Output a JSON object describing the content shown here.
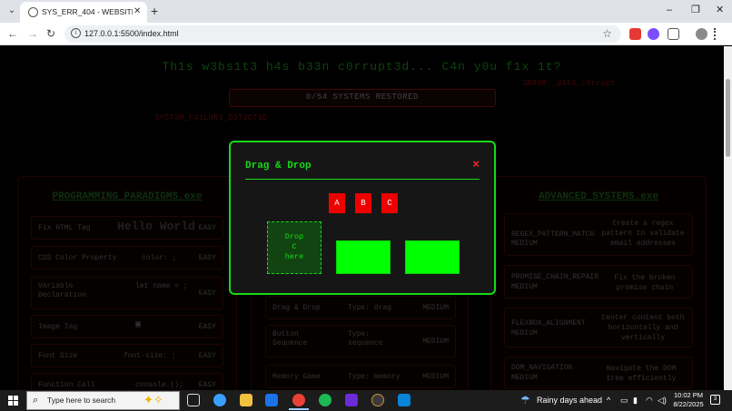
{
  "browser": {
    "tab_title": "SYS_ERR_404 - WEBSITE CORRUPTED",
    "url": "127.0.0.1:5500/index.html",
    "new_tab": "+",
    "tab_close": "✕",
    "window_buttons": {
      "minimize": "–",
      "restore": "❐",
      "close": "✕"
    }
  },
  "page": {
    "heading": "Th1s w3bs1t3 h4s b33n c0rrupt3d... C4n y0u f1x 1t?",
    "glitch_red_1": "3RR0R:_d4t4_c0rrupt",
    "glitch_red_2": "SYST3M_F41LUR3_D3T3CT3D",
    "progress": "0/54 SYSTEMS RESTORED"
  },
  "panels": {
    "left": {
      "title": "PROGRAMMING_PARADIGMS.exe",
      "cards": [
        {
          "name": "Fix HTML Tag",
          "preview": "Hello World",
          "level": "EASY"
        },
        {
          "name": "CSS Color Property",
          "preview": "color: ;",
          "level": "EASY"
        },
        {
          "name": "Variable Declaration",
          "preview": "let name = ;",
          "level": "EASY"
        },
        {
          "name": "Image Tag",
          "preview": "▣",
          "level": "EASY"
        },
        {
          "name": "Font Size",
          "preview": "font-size: ;",
          "level": "EASY"
        },
        {
          "name": "Function Call",
          "preview": "console.();",
          "level": "EASY"
        }
      ]
    },
    "middle": {
      "cards": [
        {
          "name": "Drag & Drop",
          "type": "Type: drag",
          "level": "MEDIUM"
        },
        {
          "name": "Button Sequence",
          "type": "Type: sequence",
          "level": "MEDIUM"
        },
        {
          "name": "Memory Game",
          "type": "Type: memory",
          "level": "MEDIUM"
        }
      ]
    },
    "right": {
      "title": "ADVANCED_SYSTEMS.exe",
      "cards": [
        {
          "name": "REGEX_PATTERN_MATCH",
          "level": "MEDIUM",
          "desc": "Create a regex pattern to validate email addresses"
        },
        {
          "name": "PROMISE_CHAIN_REPAIR",
          "level": "MEDIUM",
          "desc": "Fix the broken promise chain"
        },
        {
          "name": "FLEXBOX_ALIGNMENT",
          "level": "MEDIUM",
          "desc": "Center content both horizontally and vertically"
        },
        {
          "name": "DOM_NAVIGATION",
          "level": "MEDIUM",
          "desc": "Navigate the DOM tree efficiently"
        }
      ]
    }
  },
  "modal": {
    "title": "Drag & Drop",
    "close": "×",
    "letters": [
      "A",
      "B",
      "C"
    ],
    "dropzone_text": [
      "Drop",
      "C",
      "here"
    ]
  },
  "taskbar": {
    "search_placeholder": "Type here to search",
    "weather": "Rainy days ahead",
    "time": "10:02 PM",
    "date": "8/22/2025",
    "notifications": "3"
  },
  "colors": {
    "accent_green": "#19d919",
    "drop_filled": "#00ff00",
    "letter_red": "#ee0000",
    "page_bg": "#000000"
  }
}
